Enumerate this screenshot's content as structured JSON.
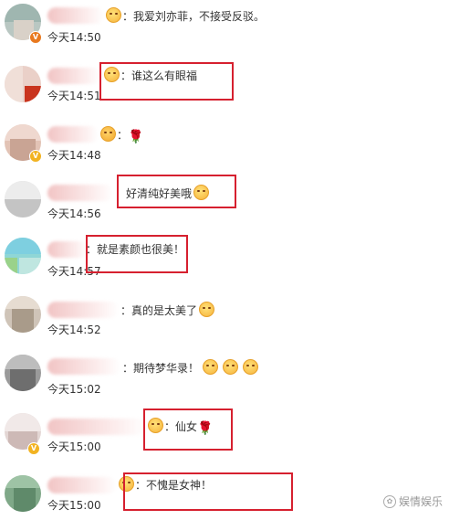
{
  "comments": [
    {
      "text": "：我爱刘亦菲，不接受反驳。",
      "time": "今天14:50",
      "badge_color": "#e8791f",
      "badge": "V"
    },
    {
      "text": "：谁这么有眼福",
      "time": "今天14:51",
      "badge_color": "#e0452b",
      "badge": ""
    },
    {
      "text": "：",
      "time": "今天14:48",
      "badge_color": "#f2b322",
      "badge": "V"
    },
    {
      "text": "：好清纯好美哦",
      "time": "今天14:56",
      "badge_color": "",
      "badge": ""
    },
    {
      "text": "：就是素颜也很美！",
      "time": "今天14:57",
      "badge_color": "",
      "badge": ""
    },
    {
      "text": "：真的是太美了",
      "time": "今天14:52",
      "badge_color": "",
      "badge": ""
    },
    {
      "text": "：期待梦华录！",
      "time": "今天15:02",
      "badge_color": "",
      "badge": ""
    },
    {
      "text": "：仙女",
      "time": "今天15:00",
      "badge_color": "#f2b322",
      "badge": "V"
    },
    {
      "text": "：不愧是女神！",
      "time": "今天15:00",
      "badge_color": "",
      "badge": ""
    }
  ],
  "watermark": "娱情娱乐",
  "highlight_color": "#d6202f"
}
